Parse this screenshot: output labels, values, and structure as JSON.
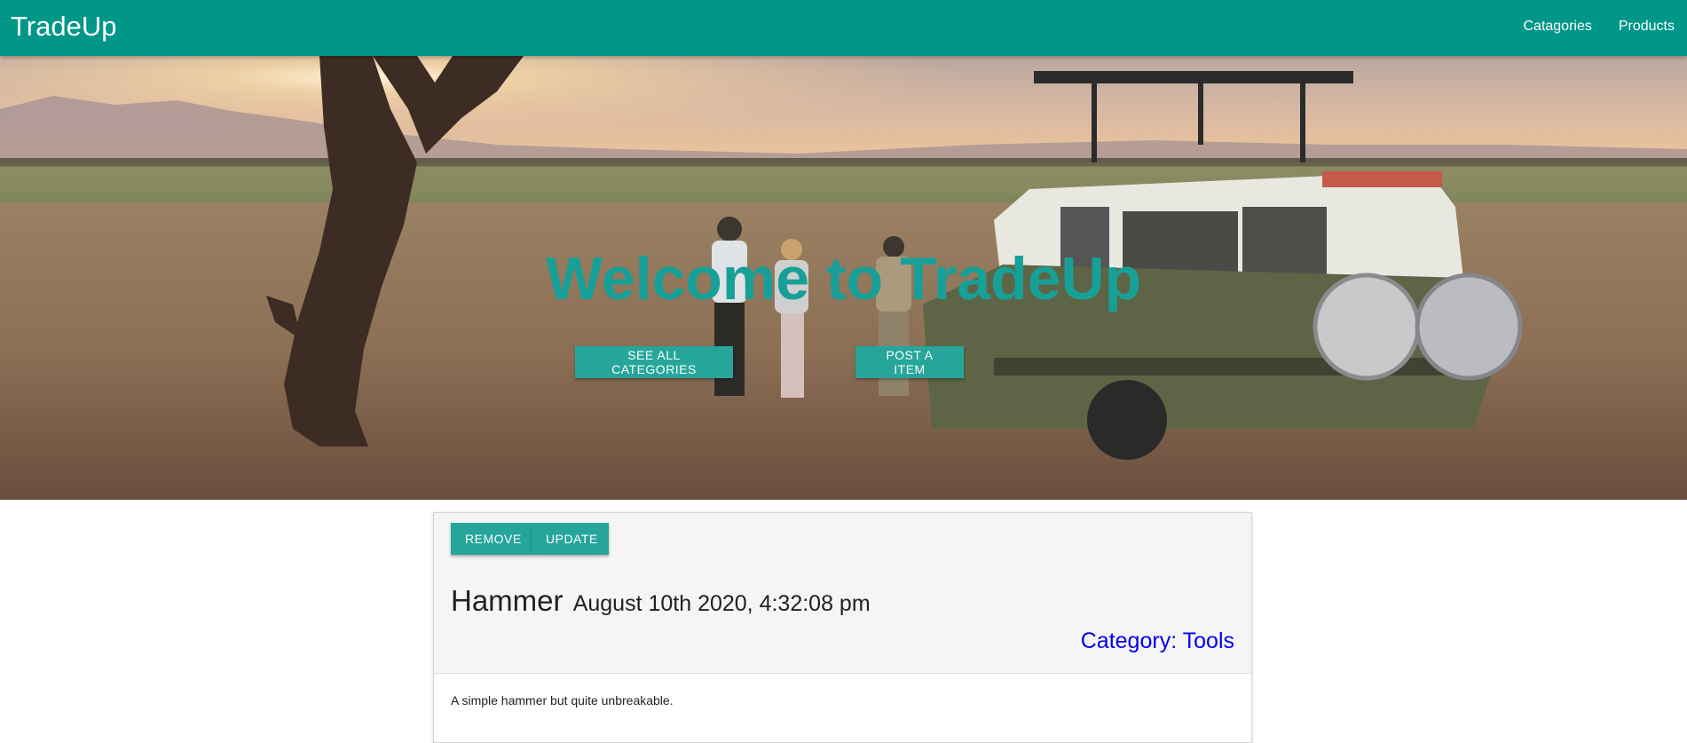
{
  "navbar": {
    "brand": "TradeUp",
    "links": [
      "Catagories",
      "Products"
    ]
  },
  "hero": {
    "title": "Welcome to TradeUp",
    "buttons": [
      "SEE ALL CATEGORIES",
      "POST A ITEM"
    ]
  },
  "item": {
    "actions": [
      "REMOVE",
      "UPDATE"
    ],
    "name": "Hammer",
    "date": "August 10th 2020, 4:32:08 pm",
    "category": "Category: Tools",
    "description": "A simple hammer but quite unbreakable."
  },
  "colors": {
    "primary": "#009688",
    "button": "#26a69a",
    "hero_title": "#17a097",
    "link": "#0000ee"
  }
}
